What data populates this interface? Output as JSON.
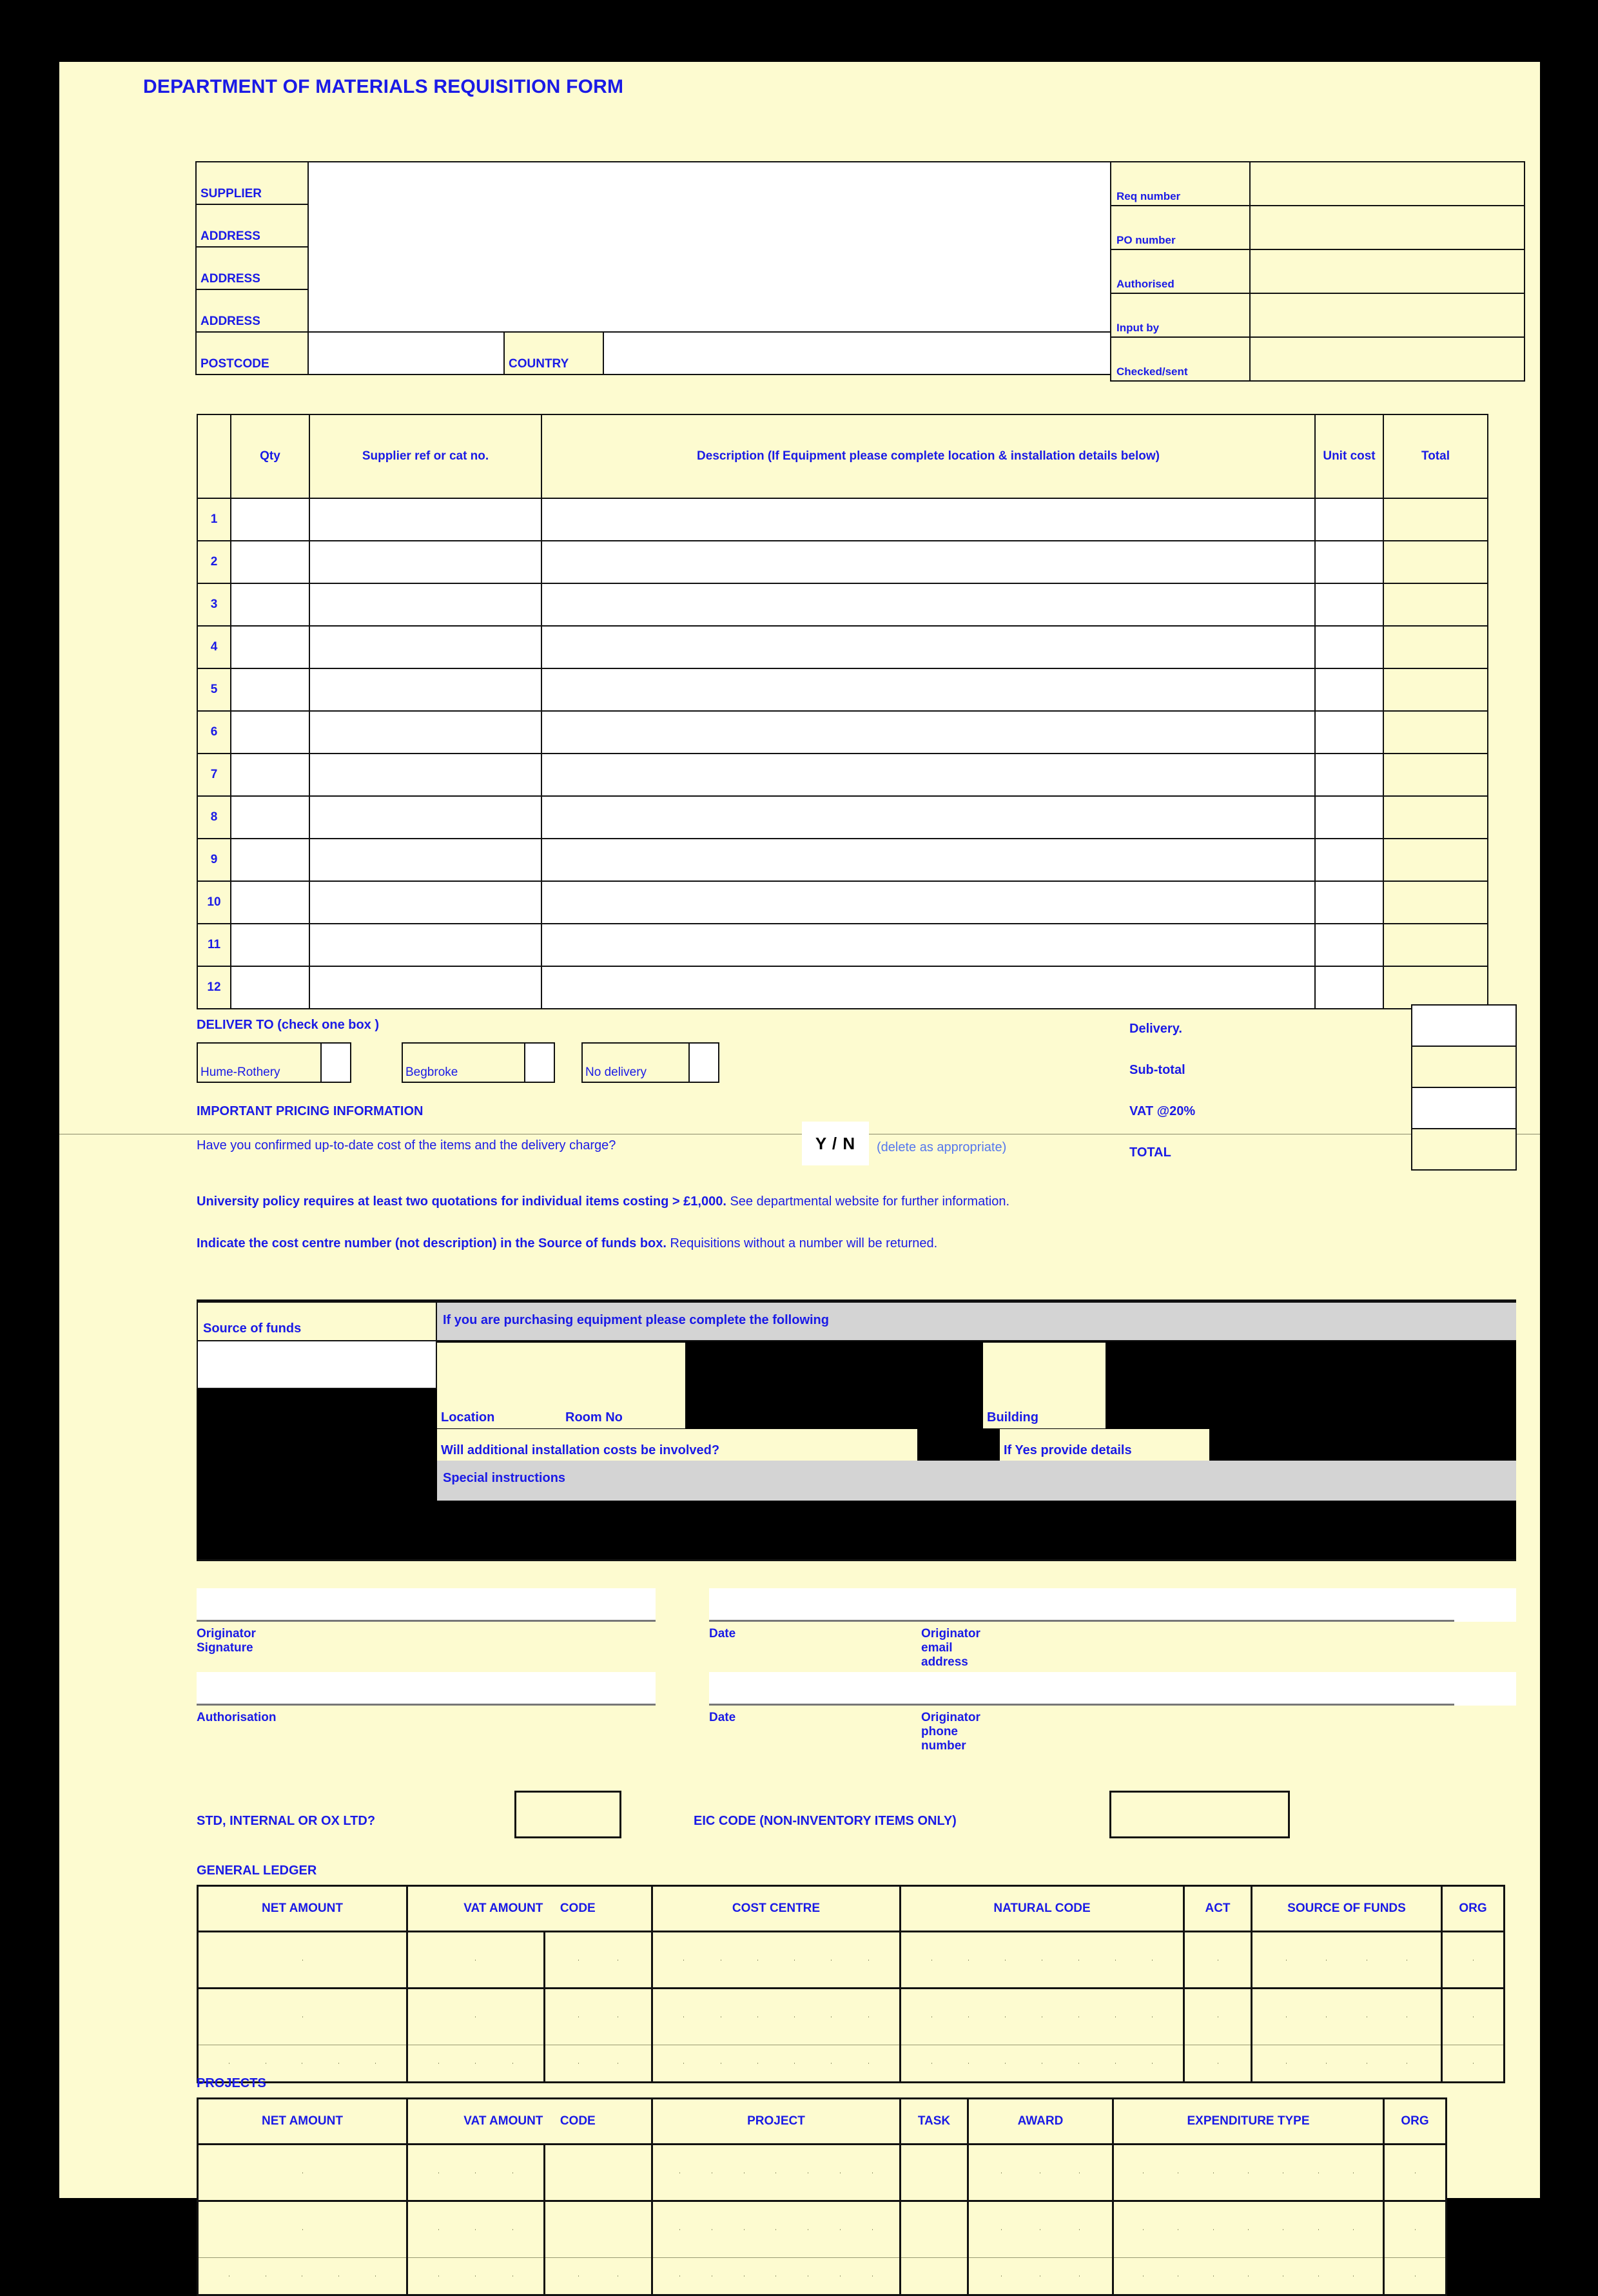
{
  "title": "DEPARTMENT OF MATERIALS REQUISITION FORM",
  "supplier_block": {
    "rows": [
      {
        "label": "SUPPLIER",
        "value": ""
      },
      {
        "label": "ADDRESS",
        "value": ""
      },
      {
        "label": "ADDRESS",
        "value": ""
      },
      {
        "label": "ADDRESS",
        "value": ""
      }
    ],
    "postcode_label": "POSTCODE",
    "postcode_value": "",
    "country_label": "COUNTRY",
    "country_value": ""
  },
  "req_block": {
    "rows": [
      {
        "label": "Req number",
        "value": ""
      },
      {
        "label": "PO number",
        "value": ""
      },
      {
        "label": "Authorised",
        "value": ""
      },
      {
        "label": "Input by",
        "value": ""
      },
      {
        "label": "Checked/sent",
        "value": ""
      }
    ]
  },
  "items_table": {
    "headers": {
      "num": "",
      "qty": "Qty",
      "ref": "Supplier ref or cat no.",
      "desc": "Description (If Equipment please complete location & installation details below)",
      "unit": "Unit cost",
      "total": "Total"
    },
    "row_numbers": [
      "1",
      "2",
      "3",
      "4",
      "5",
      "6",
      "7",
      "8",
      "9",
      "10",
      "11",
      "12"
    ]
  },
  "deliver_to": {
    "heading": "DELIVER TO (check one box )",
    "options": [
      {
        "label": "Hume-Rothery",
        "checked": ""
      },
      {
        "label": "Begbroke",
        "checked": ""
      },
      {
        "label": "No delivery",
        "checked": ""
      }
    ]
  },
  "pricing": {
    "heading": "IMPORTANT PRICING INFORMATION",
    "question": "Have you confirmed up-to-date cost of the items and the delivery charge?",
    "yn": "Y / N",
    "note": "(delete as appropriate)",
    "policy_bold_1": "University policy requires at least two quotations for individual items costing > £1,000.",
    "policy_rest_1": " See departmental website for further information.",
    "policy_bold_2": "Indicate the cost centre number (not description) in the Source of funds box.",
    "policy_rest_2": " Requisitions without a number will be returned."
  },
  "totals": {
    "labels": [
      "Delivery.",
      "Sub-total",
      "VAT  @20%",
      "TOTAL"
    ],
    "values": [
      "",
      "",
      "",
      ""
    ]
  },
  "source_of_funds": {
    "label": "Source of funds",
    "value": "",
    "equipment_heading": "If you are purchasing equipment please complete the following",
    "location_label": "Location",
    "location_value": "",
    "room_label": "Room No",
    "room_value": "",
    "building_label": "Building",
    "building_value": "",
    "install_label": "Will additional installation costs be involved?",
    "install_value": "",
    "ifyes_label": "If Yes provide details",
    "ifyes_value": "",
    "special_label": "Special instructions",
    "special_value": ""
  },
  "signatures": [
    {
      "label": "Originator Signature",
      "value": ""
    },
    {
      "label": "Date",
      "value": ""
    },
    {
      "label": "Originator email address",
      "value": ""
    },
    {
      "label": "Authorisation",
      "value": ""
    },
    {
      "label": "Date",
      "value": ""
    },
    {
      "label": "Originator phone number",
      "value": ""
    }
  ],
  "codes": {
    "std_label": "STD, INTERNAL OR OX LTD?",
    "std_value": "",
    "eic_label": "EIC CODE (NON-INVENTORY ITEMS ONLY)",
    "eic_value": ""
  },
  "general_ledger": {
    "title": "GENERAL LEDGER",
    "headers": [
      "NET AMOUNT",
      "VAT AMOUNT",
      "CODE",
      "COST CENTRE",
      "NATURAL CODE",
      "ACT",
      "SOURCE OF FUNDS",
      "ORG"
    ]
  },
  "projects": {
    "title": "PROJECTS",
    "headers": [
      "NET AMOUNT",
      "VAT AMOUNT",
      "CODE",
      "PROJECT",
      "TASK",
      "AWARD",
      "EXPENDITURE TYPE",
      "ORG"
    ]
  },
  "colors": {
    "page_bg": "#fdfbd0",
    "accent_blue": "#1a1ae6",
    "light_blue": "#5577ee",
    "grey_band": "#d4d4d4",
    "border": "#111111"
  }
}
